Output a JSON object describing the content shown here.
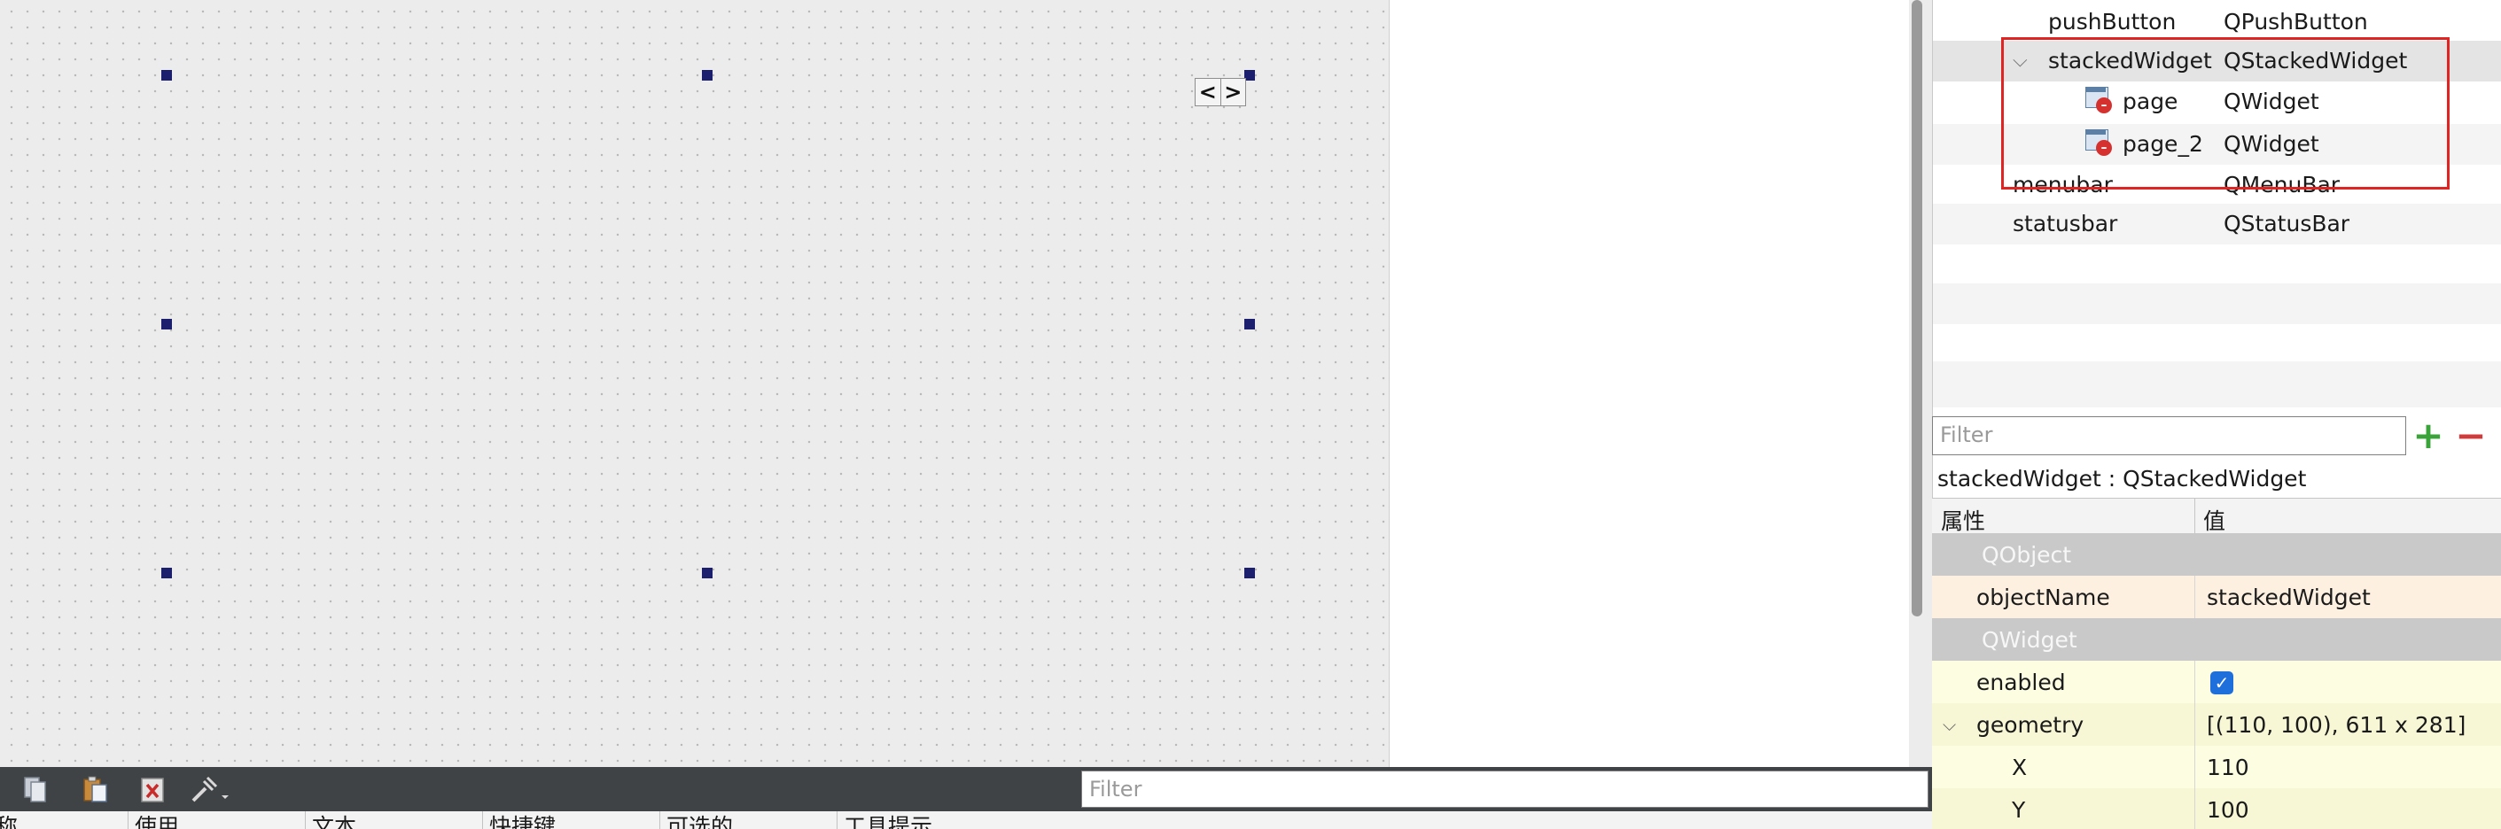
{
  "canvas": {
    "nav_prev_glyph": "<",
    "nav_next_glyph": ">"
  },
  "object_inspector": {
    "rows": [
      {
        "name": "pushButton",
        "class": "QPushButton"
      },
      {
        "name": "stackedWidget",
        "class": "QStackedWidget",
        "expanded": true
      },
      {
        "name": "page",
        "class": "QWidget",
        "icon": "widget-page-icon"
      },
      {
        "name": "page_2",
        "class": "QWidget",
        "icon": "widget-page-icon"
      },
      {
        "name": "menubar",
        "class": "QMenuBar"
      },
      {
        "name": "statusbar",
        "class": "QStatusBar"
      }
    ],
    "highlight_color": "#e02424"
  },
  "property_editor": {
    "filter_placeholder": "Filter",
    "object_label": "stackedWidget : QStackedWidget",
    "col_property": "属性",
    "col_value": "值",
    "rows": [
      {
        "type": "section",
        "name": "QObject"
      },
      {
        "type": "prop",
        "name": "objectName",
        "value": "stackedWidget"
      },
      {
        "type": "section",
        "name": "QWidget"
      },
      {
        "type": "prop",
        "name": "enabled",
        "value": "✓",
        "checked": true
      },
      {
        "type": "prop",
        "name": "geometry",
        "value": "[(110, 100), 611 x 281]",
        "expanded": true
      },
      {
        "type": "subprop",
        "name": "X",
        "value": "110"
      },
      {
        "type": "subprop",
        "name": "Y",
        "value": "100"
      }
    ]
  },
  "bottom_panel": {
    "filter_placeholder": "Filter",
    "columns": [
      "名称",
      "使用",
      "文本",
      "快捷键",
      "可选的",
      "工具提示"
    ],
    "toolbar_icons": [
      "copy-icon",
      "paste-icon",
      "delete-icon",
      "configure-icon"
    ]
  },
  "colors": {
    "selection_handle": "#1b1f6e",
    "toolbar_bg": "#3f4345",
    "checkbox_blue": "#1e6fdc",
    "plus_green": "#3aa33a",
    "minus_red": "#d23b3b"
  }
}
